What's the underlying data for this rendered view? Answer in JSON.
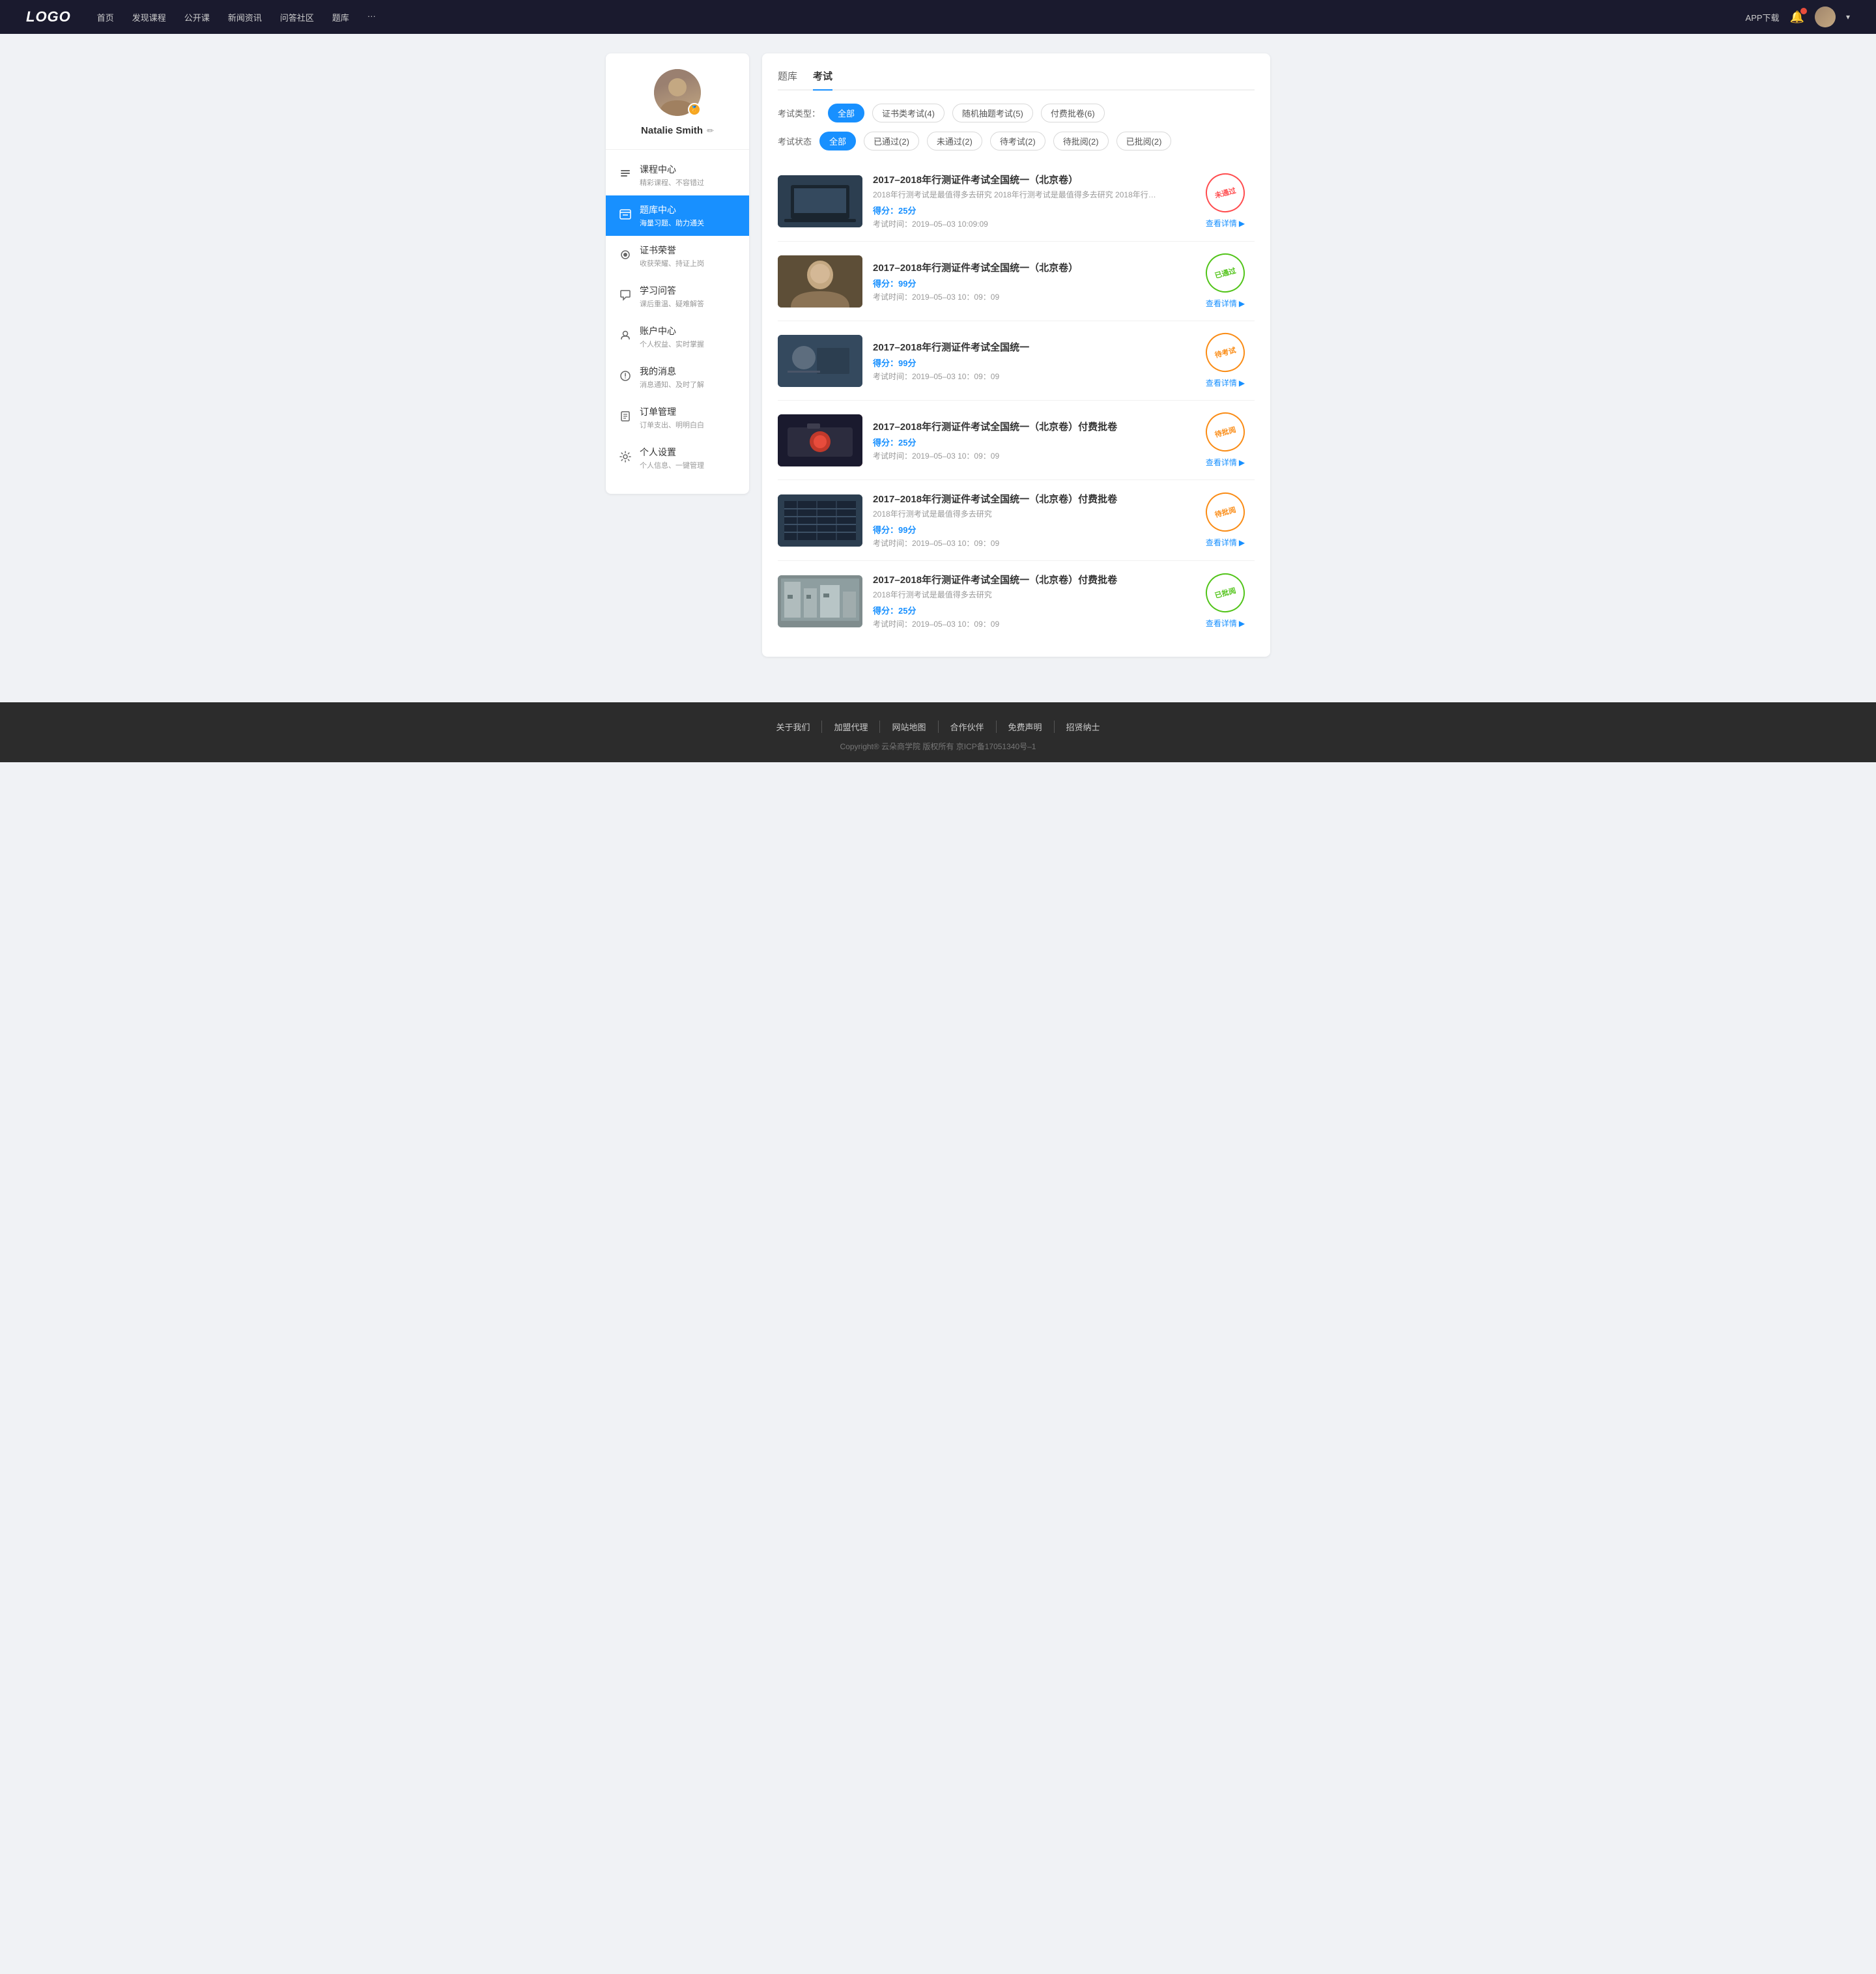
{
  "header": {
    "logo": "LOGO",
    "nav": [
      {
        "label": "首页"
      },
      {
        "label": "发现课程"
      },
      {
        "label": "公开课"
      },
      {
        "label": "新闻资讯"
      },
      {
        "label": "问答社区"
      },
      {
        "label": "题库"
      },
      {
        "label": "···"
      }
    ],
    "app_download": "APP下载",
    "caret": "▾"
  },
  "sidebar": {
    "user_name": "Natalie Smith",
    "badge_icon": "🏅",
    "edit_icon": "✏",
    "nav_items": [
      {
        "icon": "📅",
        "text": "课程中心",
        "sub": "精彩课程、不容错过",
        "active": false
      },
      {
        "icon": "📋",
        "text": "题库中心",
        "sub": "海量习题、助力通关",
        "active": true
      },
      {
        "icon": "🏆",
        "text": "证书荣誉",
        "sub": "收获荣耀、持证上岗",
        "active": false
      },
      {
        "icon": "💬",
        "text": "学习问答",
        "sub": "课后重温、疑难解答",
        "active": false
      },
      {
        "icon": "💎",
        "text": "账户中心",
        "sub": "个人权益、实时掌握",
        "active": false
      },
      {
        "icon": "🔔",
        "text": "我的消息",
        "sub": "消息通知、及时了解",
        "active": false
      },
      {
        "icon": "📄",
        "text": "订单管理",
        "sub": "订单支出、明明白白",
        "active": false
      },
      {
        "icon": "⚙",
        "text": "个人设置",
        "sub": "个人信息、一键管理",
        "active": false
      }
    ]
  },
  "content": {
    "tab_bank": "题库",
    "tab_exam": "考试",
    "active_tab": "exam",
    "filter_type_label": "考试类型：",
    "filter_type_options": [
      {
        "label": "全部",
        "active": true
      },
      {
        "label": "证书类考试(4)",
        "active": false
      },
      {
        "label": "随机抽题考试(5)",
        "active": false
      },
      {
        "label": "付费批卷(6)",
        "active": false
      }
    ],
    "filter_status_label": "考试状态",
    "filter_status_options": [
      {
        "label": "全部",
        "active": true
      },
      {
        "label": "已通过(2)",
        "active": false
      },
      {
        "label": "未通过(2)",
        "active": false
      },
      {
        "label": "待考试(2)",
        "active": false
      },
      {
        "label": "待批阅(2)",
        "active": false
      },
      {
        "label": "已批阅(2)",
        "active": false
      }
    ],
    "exams": [
      {
        "title": "2017–2018年行测证件考试全国统一（北京卷）",
        "desc": "2018年行测考试是最值得多去研究 2018年行测考试是最值得多去研究 2018年行…",
        "score_label": "得分：",
        "score": "25",
        "score_unit": "分",
        "time_label": "考试时间：",
        "time": "2019–05–03  10:09:09",
        "status_text": "未通过",
        "status_type": "fail",
        "detail_link": "查看详情",
        "thumb_class": "thumb-laptop"
      },
      {
        "title": "2017–2018年行测证件考试全国统一（北京卷）",
        "desc": "",
        "score_label": "得分：",
        "score": "99",
        "score_unit": "分",
        "time_label": "考试时间：",
        "time": "2019–05–03  10：09：09",
        "status_text": "已通过",
        "status_type": "pass",
        "detail_link": "查看详情",
        "thumb_class": "thumb-woman"
      },
      {
        "title": "2017–2018年行测证件考试全国统一",
        "desc": "",
        "score_label": "得分：",
        "score": "99",
        "score_unit": "分",
        "time_label": "考试时间：",
        "time": "2019–05–03  10：09：09",
        "status_text": "待考试",
        "status_type": "pending",
        "detail_link": "查看详情",
        "thumb_class": "thumb-man"
      },
      {
        "title": "2017–2018年行测证件考试全国统一（北京卷）付费批卷",
        "desc": "",
        "score_label": "得分：",
        "score": "25",
        "score_unit": "分",
        "time_label": "考试时间：",
        "time": "2019–05–03  10：09：09",
        "status_text": "待批阅",
        "status_type": "review",
        "detail_link": "查看详情",
        "thumb_class": "thumb-camera"
      },
      {
        "title": "2017–2018年行测证件考试全国统一（北京卷）付费批卷",
        "desc": "2018年行测考试是最值得多去研究",
        "score_label": "得分：",
        "score": "99",
        "score_unit": "分",
        "time_label": "考试时间：",
        "time": "2019–05–03  10：09：09",
        "status_text": "待批阅",
        "status_type": "review",
        "detail_link": "查看详情",
        "thumb_class": "thumb-building1"
      },
      {
        "title": "2017–2018年行测证件考试全国统一（北京卷）付费批卷",
        "desc": "2018年行测考试是最值得多去研究",
        "score_label": "得分：",
        "score": "25",
        "score_unit": "分",
        "time_label": "考试时间：",
        "time": "2019–05–03  10：09：09",
        "status_text": "已批阅",
        "status_type": "reviewed",
        "detail_link": "查看详情",
        "thumb_class": "thumb-building2"
      }
    ]
  },
  "footer": {
    "links": [
      {
        "label": "关于我们"
      },
      {
        "label": "加盟代理"
      },
      {
        "label": "网站地图"
      },
      {
        "label": "合作伙伴"
      },
      {
        "label": "免费声明"
      },
      {
        "label": "招贤纳士"
      }
    ],
    "copyright": "Copyright® 云朵商学院  版权所有    京ICP备17051340号–1"
  },
  "stamp_labels": {
    "fail": "未通过",
    "pass": "已通过",
    "pending": "待考试",
    "review": "待批阅",
    "reviewed": "已批阅"
  }
}
